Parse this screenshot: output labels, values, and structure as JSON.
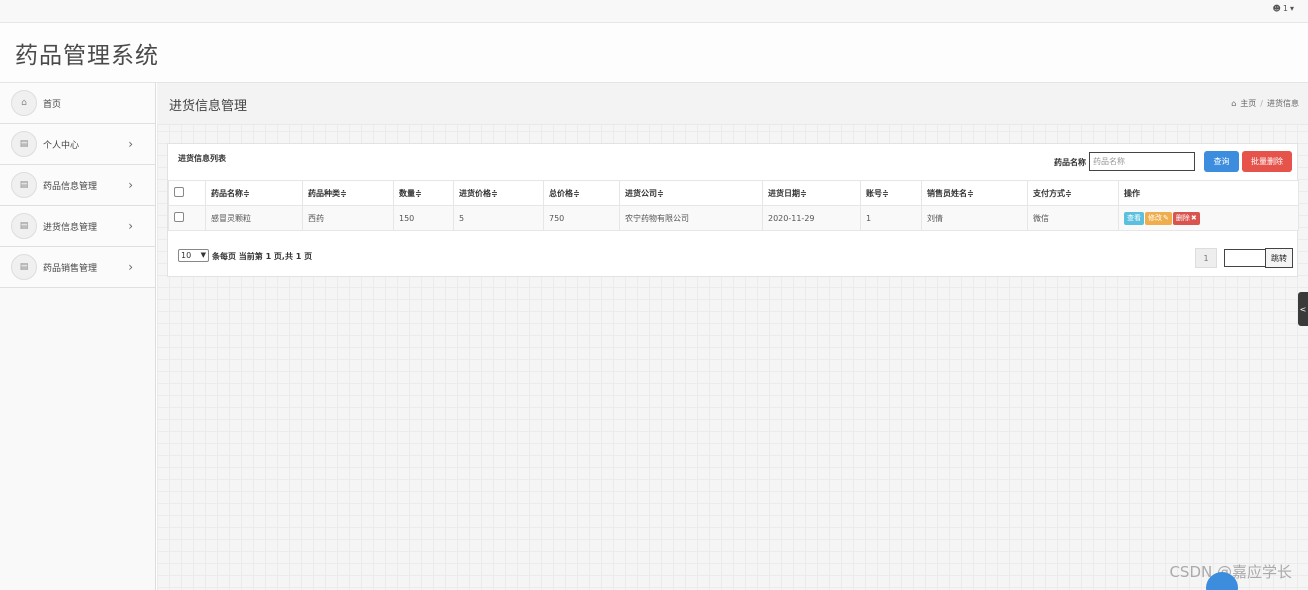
{
  "topbar": {
    "user_label": "1"
  },
  "header": {
    "title": "药品管理系统"
  },
  "sidebar": {
    "items": [
      {
        "label": "首页",
        "icon": "home-icon",
        "has_chevron": false
      },
      {
        "label": "个人中心",
        "icon": "list-icon",
        "has_chevron": true
      },
      {
        "label": "药品信息管理",
        "icon": "list-icon",
        "has_chevron": true
      },
      {
        "label": "进货信息管理",
        "icon": "list-icon",
        "has_chevron": true
      },
      {
        "label": "药品销售管理",
        "icon": "list-icon",
        "has_chevron": true
      }
    ]
  },
  "page": {
    "title": "进货信息管理",
    "breadcrumb": [
      "主页",
      "进货信息"
    ]
  },
  "panel": {
    "title": "进货信息列表",
    "search_label": "药品名称",
    "search_placeholder": "药品名称",
    "search_button": "查询",
    "batch_delete_button": "批量删除"
  },
  "table": {
    "headers": [
      "药品名称≑",
      "药品种类≑",
      "数量≑",
      "进货价格≑",
      "总价格≑",
      "进货公司≑",
      "进货日期≑",
      "账号≑",
      "销售员姓名≑",
      "支付方式≑",
      "操作"
    ],
    "rows": [
      [
        "感冒灵颗粒",
        "西药",
        "150",
        "5",
        "750",
        "农宁药物有限公司",
        "2020-11-29",
        "1",
        "刘倩",
        "微信"
      ]
    ],
    "actions": {
      "view": "查看",
      "edit": "修改",
      "delete": "删除"
    }
  },
  "pager": {
    "page_size": "10",
    "summary": "条每页 当前第 1 页,共 1 页",
    "current_page": "1",
    "jump_button": "跳转"
  },
  "watermark": "CSDN @嘉应学长",
  "colors": {
    "primary": "#3c8dde",
    "danger": "#e5534b",
    "info": "#5bc0de",
    "warning": "#f0ad4e"
  }
}
